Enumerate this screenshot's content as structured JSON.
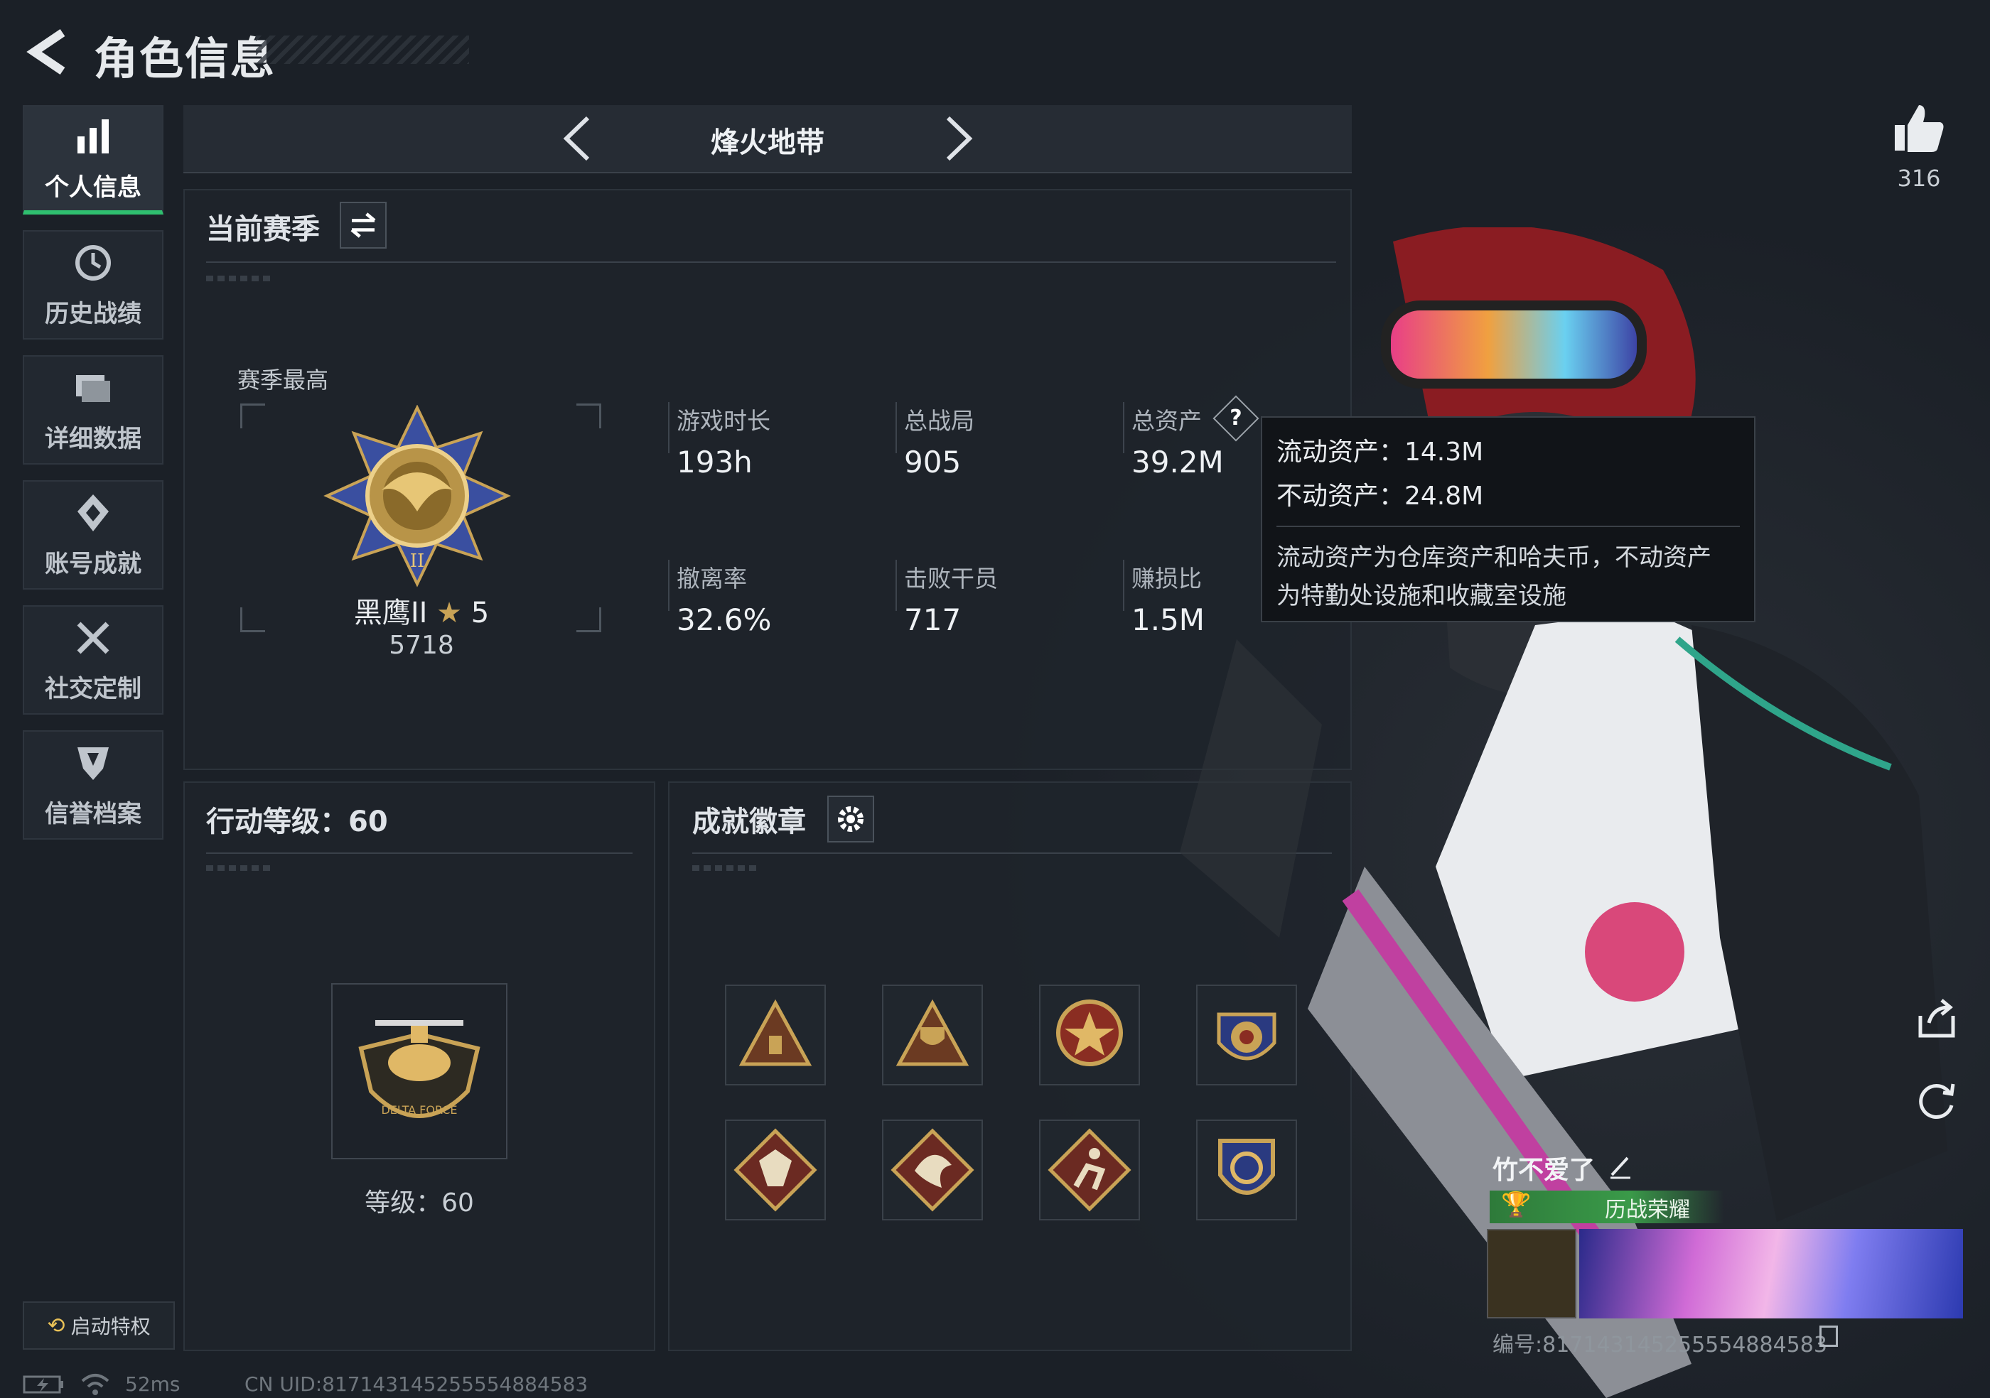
{
  "header": {
    "title": "角色信息"
  },
  "sidebar": {
    "items": [
      {
        "label": "个人信息",
        "icon": "bar-chart-icon",
        "active": true
      },
      {
        "label": "历史战绩",
        "icon": "history-icon"
      },
      {
        "label": "详细数据",
        "icon": "folder-icon"
      },
      {
        "label": "账号成就",
        "icon": "achievement-icon"
      },
      {
        "label": "社交定制",
        "icon": "tools-icon"
      },
      {
        "label": "信誉档案",
        "icon": "shield-icon"
      }
    ],
    "privilege_label": "启动特权"
  },
  "mode": {
    "name": "烽火地带"
  },
  "season": {
    "title": "当前赛季",
    "best_label": "赛季最高",
    "rank_name": "黑鹰II",
    "rank_stars": "5",
    "rank_score": "5718",
    "stats": [
      {
        "label": "游戏时长",
        "value": "193h"
      },
      {
        "label": "总战局",
        "value": "905"
      },
      {
        "label": "总资产",
        "value": "39.2M"
      },
      {
        "label": "撤离率",
        "value": "32.6%"
      },
      {
        "label": "击败干员",
        "value": "717"
      },
      {
        "label": "赚损比",
        "value": "1.5M"
      }
    ],
    "help_glyph": "?"
  },
  "tooltip": {
    "liquid": "流动资产：14.3M",
    "fixed": "不动资产：24.8M",
    "desc_line1": "流动资产为仓库资产和哈夫币，不动资产",
    "desc_line2": "为特勤处设施和收藏室设施"
  },
  "level": {
    "title": "行动等级：60",
    "label": "等级：60"
  },
  "badges": {
    "title": "成就徽章",
    "items": [
      "badge-triangle-bronze",
      "badge-triangle-trophy",
      "badge-star-shield",
      "badge-crest-stars",
      "badge-wolf-diamond",
      "badge-dragon-diamond",
      "badge-runner-diamond",
      "badge-shield-gold"
    ]
  },
  "profile": {
    "likes": "316",
    "name": "竹不爱了",
    "honor": "历战荣耀",
    "id_text": "编号:81714314525555488458​3"
  },
  "status": {
    "ping": "52ms",
    "uid": "CN UID:8171431452555548845​83"
  },
  "colors": {
    "accent": "#2fbf6f",
    "gold": "#c9a356"
  }
}
